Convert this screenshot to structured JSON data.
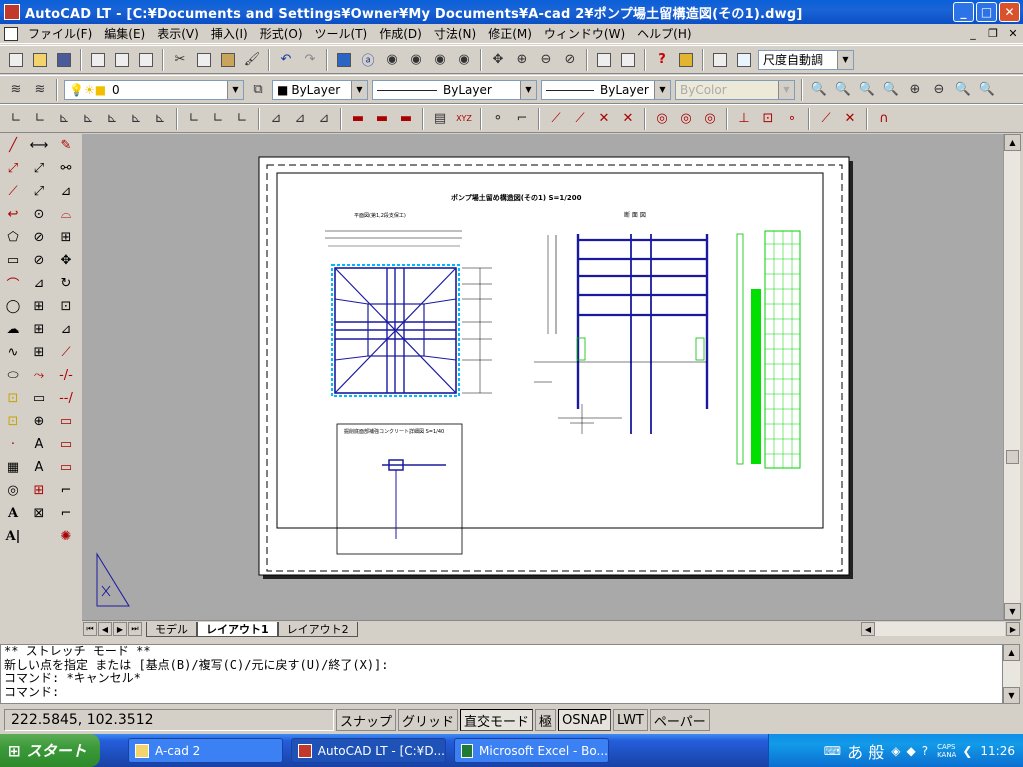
{
  "window": {
    "title": "AutoCAD LT - [C:¥Documents and Settings¥Owner¥My Documents¥A-cad 2¥ポンプ場土留構造図(その1).dwg]",
    "minimize": "_",
    "maximize": "□",
    "close": "✕"
  },
  "menu": {
    "items": [
      "ファイル(F)",
      "編集(E)",
      "表示(V)",
      "挿入(I)",
      "形式(O)",
      "ツール(T)",
      "作成(D)",
      "寸法(N)",
      "修正(M)",
      "ウィンドウ(W)",
      "ヘルプ(H)"
    ],
    "mdi_minimize": "_",
    "mdi_restore": "❐",
    "mdi_close": "✕"
  },
  "toolbar": {
    "dimscale_combo": "尺度自動調",
    "layer_combo": "0",
    "color_combo": "ByLayer",
    "linetype_combo": "ByLayer",
    "lineweight_combo": "ByLayer",
    "plotstyle_combo": "ByColor"
  },
  "drawing": {
    "title": "ポンプ場土留め構造図(その1)  S=1/200",
    "plan_label": "平面図(第1,2段支保工)",
    "section_label": "断 面 図",
    "detail_label": "掘削底面部補強コンクリート詳細図 S=1/40"
  },
  "layout_tabs": [
    "モデル",
    "レイアウト1",
    "レイアウト2"
  ],
  "active_tab": "レイアウト1",
  "command_lines": [
    "** ストレッチ モード **",
    "新しい点を指定 または [基点(B)/複写(C)/元に戻す(U)/終了(X)]:",
    "コマンド: *キャンセル*",
    "コマンド:"
  ],
  "status": {
    "coordinates": "222.5845, 102.3512",
    "toggles": [
      "スナップ",
      "グリッド",
      "直交モード",
      "極",
      "OSNAP",
      "LWT",
      "ペーパー"
    ],
    "on_toggles": [
      "直交モード",
      "OSNAP"
    ]
  },
  "taskbar": {
    "start": "スタート",
    "buttons": [
      "A-cad 2",
      "AutoCAD LT - [C:¥D...",
      "Microsoft Excel - Bo..."
    ],
    "ime": "あ 般",
    "caps": "CAPS",
    "kana": "KANA",
    "clock": "11:26"
  },
  "colors": {
    "titlebar": "#0a5fd8",
    "drawing_bg": "#a9a9a9",
    "cad_blue": "#1a1aa0",
    "cad_cyan": "#00c0ff",
    "cad_green": "#00e000"
  }
}
